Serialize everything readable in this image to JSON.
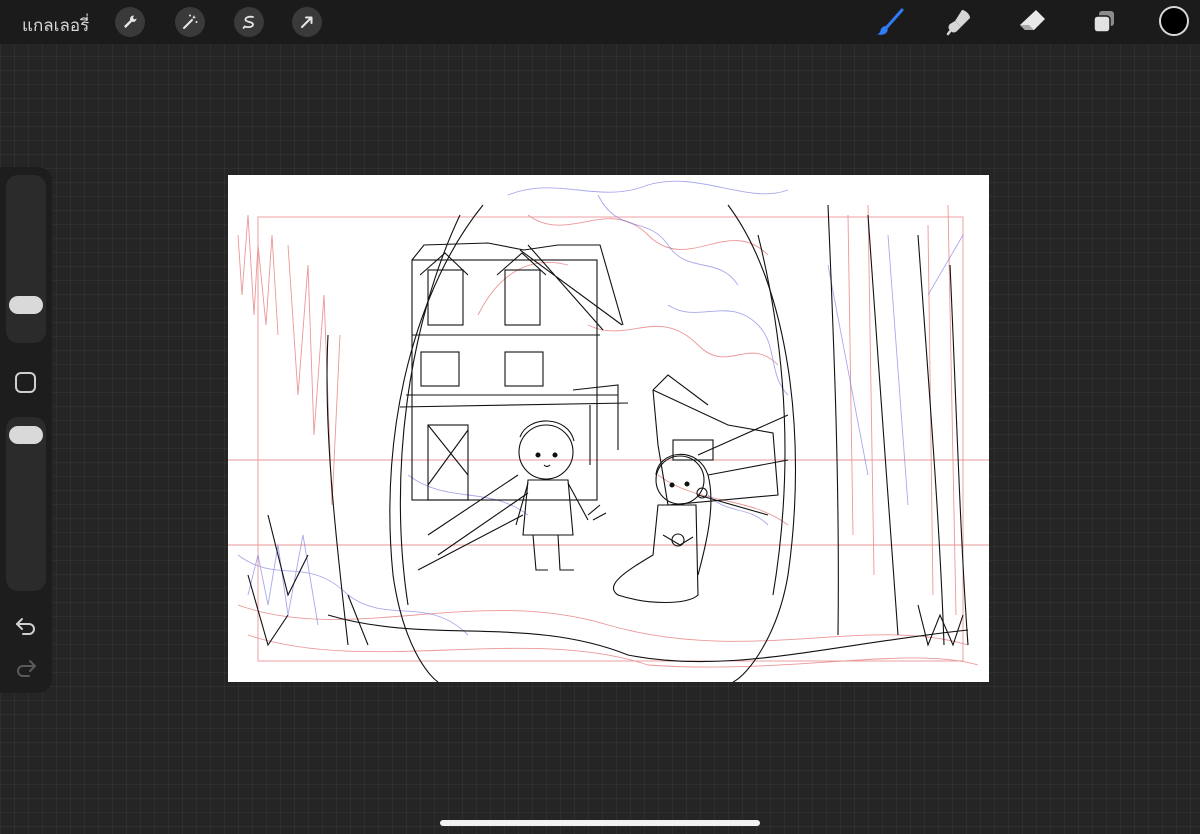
{
  "topbar": {
    "gallery_label": "แกลเลอรี่",
    "action_icons": [
      "wrench-icon",
      "magic-wand-icon",
      "selection-icon",
      "transform-arrow-icon"
    ],
    "tool_icons": [
      "brush-icon",
      "smudge-icon",
      "eraser-icon",
      "layers-icon"
    ],
    "active_tool": "brush",
    "active_tool_color": "#2f7cf6",
    "current_color": "#000000"
  },
  "sidebar": {
    "brush_size_level": 0.7,
    "opacity_level": 0.85,
    "controls": [
      "brush-size-slider",
      "modify-button",
      "opacity-slider",
      "undo-icon",
      "redo-icon"
    ]
  },
  "canvas": {
    "content": "sketch-artwork",
    "background": "#ffffff",
    "stroke_colors": [
      "#111111",
      "#e05a5a",
      "#6a6ae0"
    ]
  }
}
